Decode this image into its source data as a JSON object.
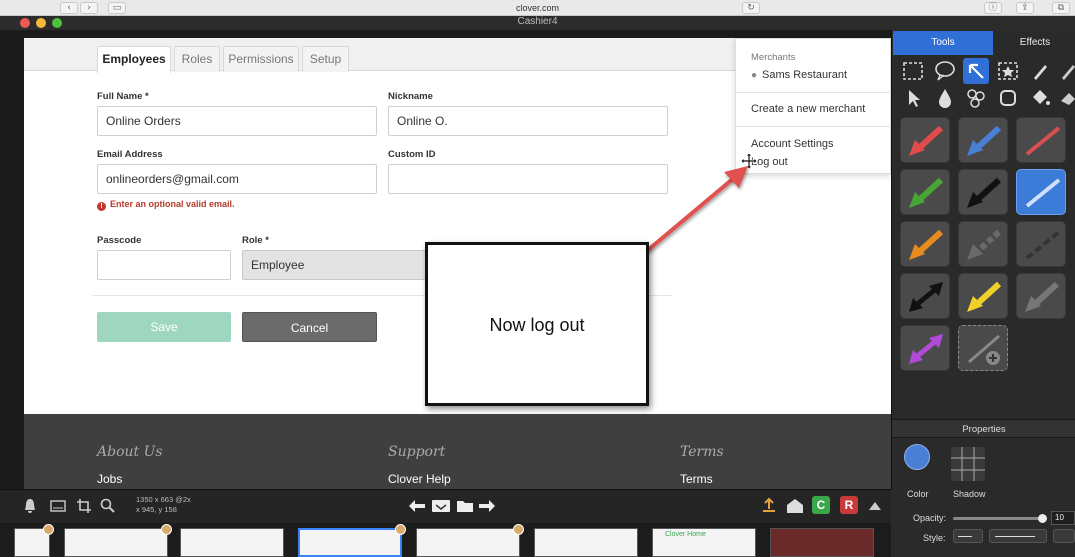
{
  "browser": {
    "url": "clover.com",
    "window_title": "Cashier4"
  },
  "form": {
    "tabs": [
      "Employees",
      "Roles",
      "Permissions",
      "Setup"
    ],
    "full_name_label": "Full Name *",
    "full_name_value": "Online Orders",
    "nickname_label": "Nickname",
    "nickname_value": "Online O.",
    "email_label": "Email Address",
    "email_value": "onlineorders@gmail.com",
    "email_error": "Enter an optional valid email.",
    "custom_id_label": "Custom ID",
    "passcode_label": "Passcode",
    "role_label": "Role *",
    "role_value": "Employee",
    "save_label": "Save",
    "cancel_label": "Cancel"
  },
  "dropdown": {
    "header": "Merchants",
    "merchant": "Sams Restaurant",
    "create": "Create a new merchant",
    "account": "Account Settings",
    "logout": "Log out"
  },
  "footer": {
    "about": "About Us",
    "about_link": "Jobs",
    "support": "Support",
    "support_link": "Clover Help",
    "terms": "Terms",
    "terms_link": "Terms"
  },
  "annotation": {
    "text": "Now log out"
  },
  "tools_panel": {
    "tab_tools": "Tools",
    "tab_effects": "Effects",
    "properties_title": "Properties",
    "color_label": "Color",
    "shadow_label": "Shadow",
    "opacity_label": "Opacity:",
    "opacity_value": "10",
    "style_label": "Style:",
    "swatch_colors": [
      "#e24b4b",
      "#4a7fd6",
      "#d9504f",
      "#49a535",
      "#111111",
      "#3d7bd9",
      "#e88a1e",
      "#6a6a6a",
      "#333333",
      "#111111",
      "#f2d02a",
      "#777777",
      "#b24ad9"
    ]
  },
  "toolbar": {
    "dimensions": "1350 x 663 @2x",
    "coords": "x 945, y 158"
  },
  "filmstrip": {
    "thumb_labels": [
      "Clover Home"
    ]
  },
  "colors": {
    "save_button": "#9ed6c0",
    "cancel_button": "#6b6b6b",
    "footer_bg": "#3f3f3f",
    "panel_accent": "#3d7bd9",
    "arrow": "#e0514f"
  }
}
